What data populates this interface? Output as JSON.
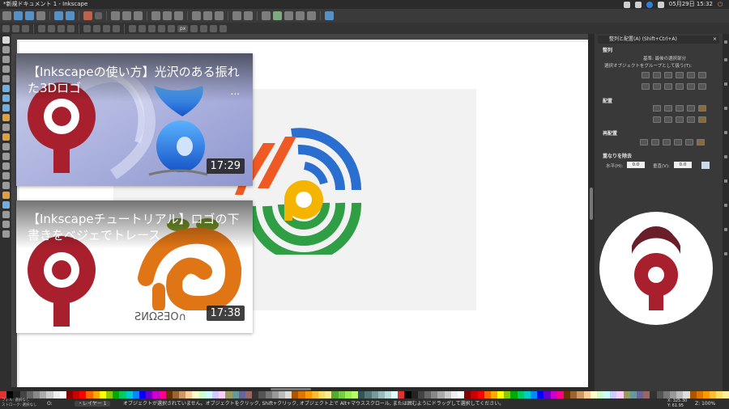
{
  "window": {
    "title": "*新規ドキュメント 1 - Inkscape"
  },
  "system": {
    "datetime": "05月29日 15:32"
  },
  "toolbar2": {
    "unit": "px"
  },
  "panel": {
    "title": "整列と配置(A) (Shift+Ctrl+A)",
    "align_section": "整列",
    "relative_label": "基準:",
    "relative_value": "最後の選択部分",
    "group_option": "選択オブジェクトをグループとして扱う(T):",
    "distribute_section": "配置",
    "rearrange_section": "再配置",
    "overlap_section": "重なりを除去",
    "h_label": "水平(H):",
    "h_value": "0.0",
    "v_label": "垂直(V):",
    "v_value": "0.0"
  },
  "videos": [
    {
      "title": "【Inkscapeの使い方】光沢のある振れた3Dロゴ",
      "duration": "17:29",
      "more": "..."
    },
    {
      "title": "【Inkscapeチュートリアル】ロゴの下書きをベジェでトレース",
      "duration": "17:38",
      "more": "..."
    }
  ],
  "status": {
    "fill_label": "フィル:",
    "fill_value": "選択なし",
    "stroke_label": "ストローク:",
    "stroke_value": "選択なし",
    "opacity_label": "O:",
    "layer_label": "・レイヤー 1",
    "message": "オブジェクトが選択されていません。オブジェクトをクリック, Shift+クリック, オブジェクト上で Alt+マウススクロール, または囲むようにドラッグして選択してください。",
    "x": "X: 325.30",
    "y": "Y: 61.95",
    "zoom_label": "Z:",
    "zoom": "100%"
  },
  "colors": {
    "logo_red": "#a8202e",
    "logo_blue": "#2a6fd0",
    "logo_green": "#2f9e44",
    "logo_orange": "#ef5a24",
    "logo_yellow": "#f5b400",
    "blue_8": "#1e7df0",
    "orange_swirl": "#e07515"
  }
}
